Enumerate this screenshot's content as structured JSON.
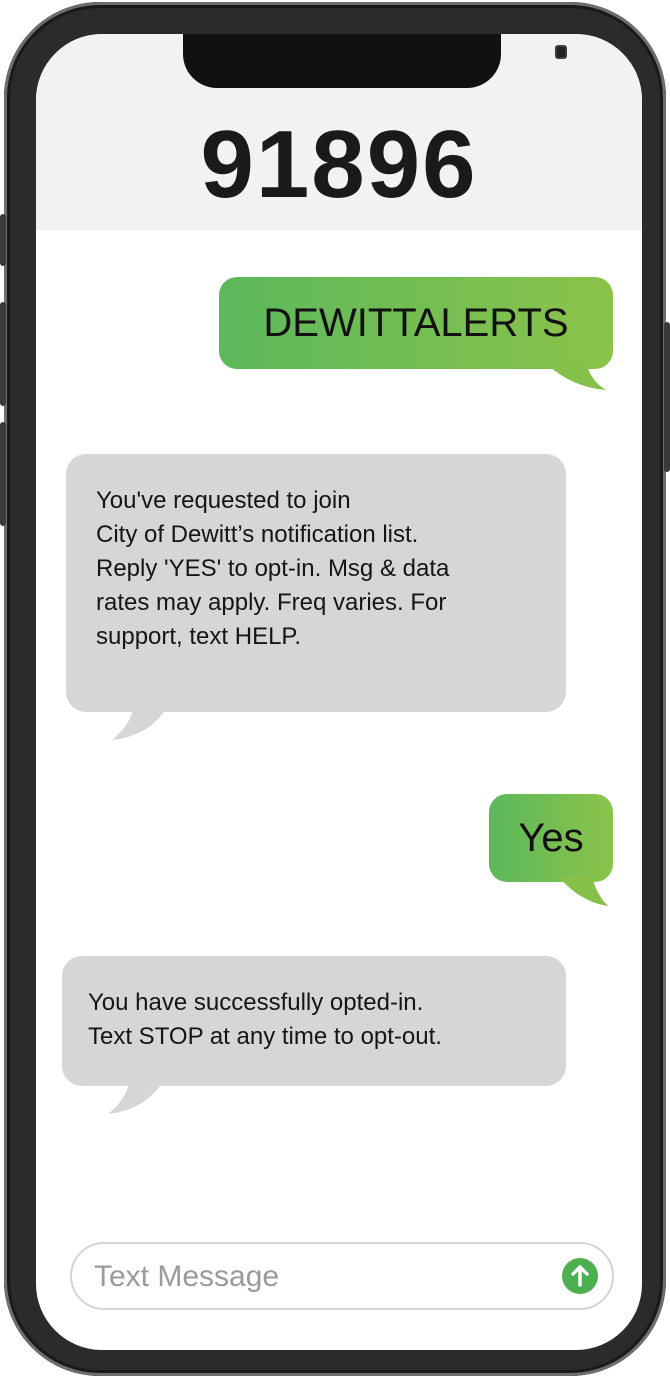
{
  "header": {
    "contact": "91896"
  },
  "messages": [
    {
      "direction": "outgoing",
      "text": "DEWITTALERTS"
    },
    {
      "direction": "incoming",
      "text": "You've requested to join\nCity of Dewitt’s notification list.\nReply 'YES' to opt-in.  Msg & data\nrates may apply. Freq varies. For\nsupport, text HELP."
    },
    {
      "direction": "outgoing",
      "text": "Yes"
    },
    {
      "direction": "incoming",
      "text": "You have successfully opted-in.\nText STOP at any time to opt-out."
    }
  ],
  "composer": {
    "placeholder": "Text Message",
    "value": ""
  },
  "icons": {
    "send": "arrow-up-icon"
  },
  "colors": {
    "outgoing_start": "#5cb85c",
    "outgoing_end": "#8bc34a",
    "incoming": "#d6d6d6",
    "send_button": "#4caf50"
  }
}
